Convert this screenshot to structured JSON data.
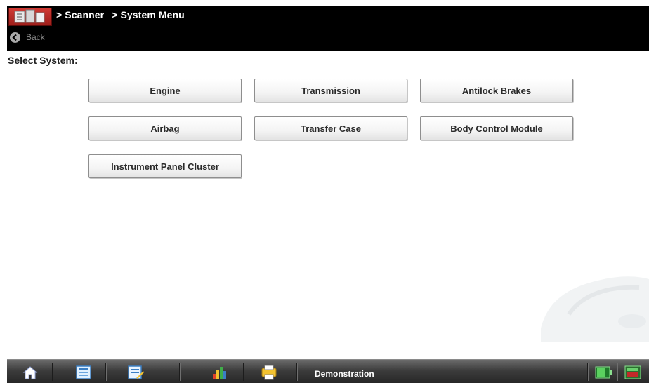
{
  "header": {
    "breadcrumb": [
      {
        "label": "> Scanner"
      },
      {
        "label": "> System Menu"
      }
    ],
    "back_label": "Back"
  },
  "main": {
    "prompt": "Select System:",
    "systems": [
      {
        "label": "Engine"
      },
      {
        "label": "Transmission"
      },
      {
        "label": "Antilock Brakes"
      },
      {
        "label": "Airbag"
      },
      {
        "label": "Transfer Case"
      },
      {
        "label": "Body Control Module"
      },
      {
        "label": "Instrument Panel Cluster"
      }
    ]
  },
  "taskbar": {
    "mode_label": "Demonstration",
    "icons": [
      "home-icon",
      "toolbar-icon",
      "edit-list-icon",
      "data-icon",
      "printer-icon",
      "battery-icon",
      "connection-icon"
    ]
  },
  "colors": {
    "header_bg": "#000000",
    "logo_red": "#c8302b",
    "taskbar_bg": "#3c3c3c",
    "button_border": "#8e8e8e"
  }
}
